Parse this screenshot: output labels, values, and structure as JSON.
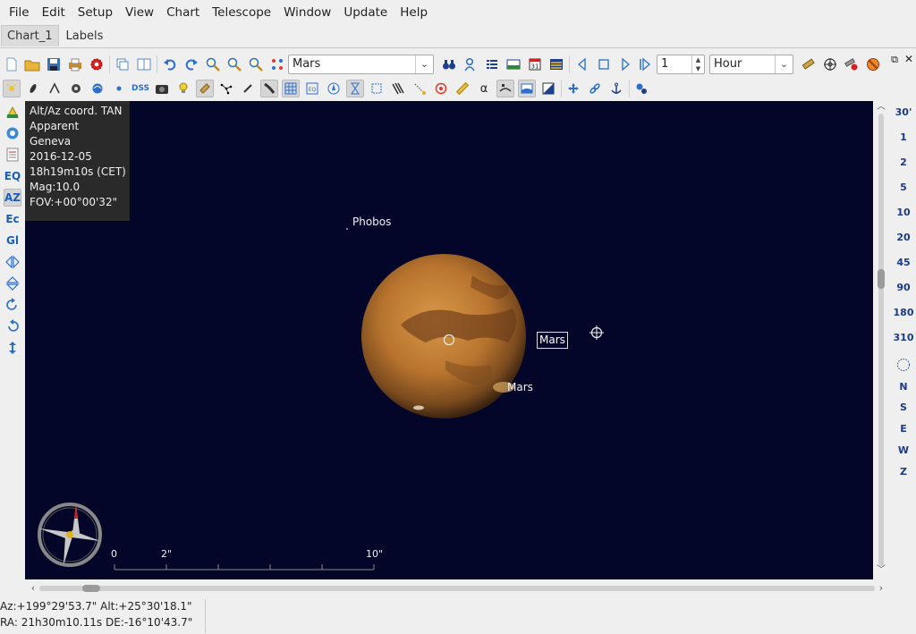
{
  "menu": [
    "File",
    "Edit",
    "Setup",
    "View",
    "Chart",
    "Telescope",
    "Window",
    "Update",
    "Help"
  ],
  "tabs": [
    {
      "label": "Chart_1",
      "active": true
    },
    {
      "label": "Labels",
      "active": false
    }
  ],
  "toolbar": {
    "search_object": "Mars",
    "time_step_value": "1",
    "time_unit": "Hour"
  },
  "left_toolbar": {
    "items": [
      "EQ",
      "AZ",
      "Ec",
      "Gl"
    ]
  },
  "info_box": {
    "lines": [
      "Alt/Az coord. TAN",
      "Apparent",
      "Geneva",
      "2016-12-05",
      "18h19m10s (CET)",
      "Mag:10.0",
      "FOV:+00°00'32\""
    ]
  },
  "chart": {
    "labels": {
      "phobos": "Phobos",
      "mars": "Mars",
      "mars_tag": "Mars"
    },
    "scale": {
      "ticks": [
        "0",
        "2\"",
        "10\""
      ]
    },
    "colors": {
      "sky": "#030628",
      "planet": "#b8742e"
    }
  },
  "fov_toolbar": {
    "items": [
      "30'",
      "1",
      "2",
      "5",
      "10",
      "20",
      "45",
      "90",
      "180",
      "310"
    ],
    "directions": [
      "N",
      "S",
      "E",
      "W",
      "Z"
    ]
  },
  "status": {
    "altaz": "Az:+199°29'53.7\" Alt:+25°30'18.1\"",
    "radec": "RA: 21h30m10.11s DE:-16°10'43.7\""
  }
}
